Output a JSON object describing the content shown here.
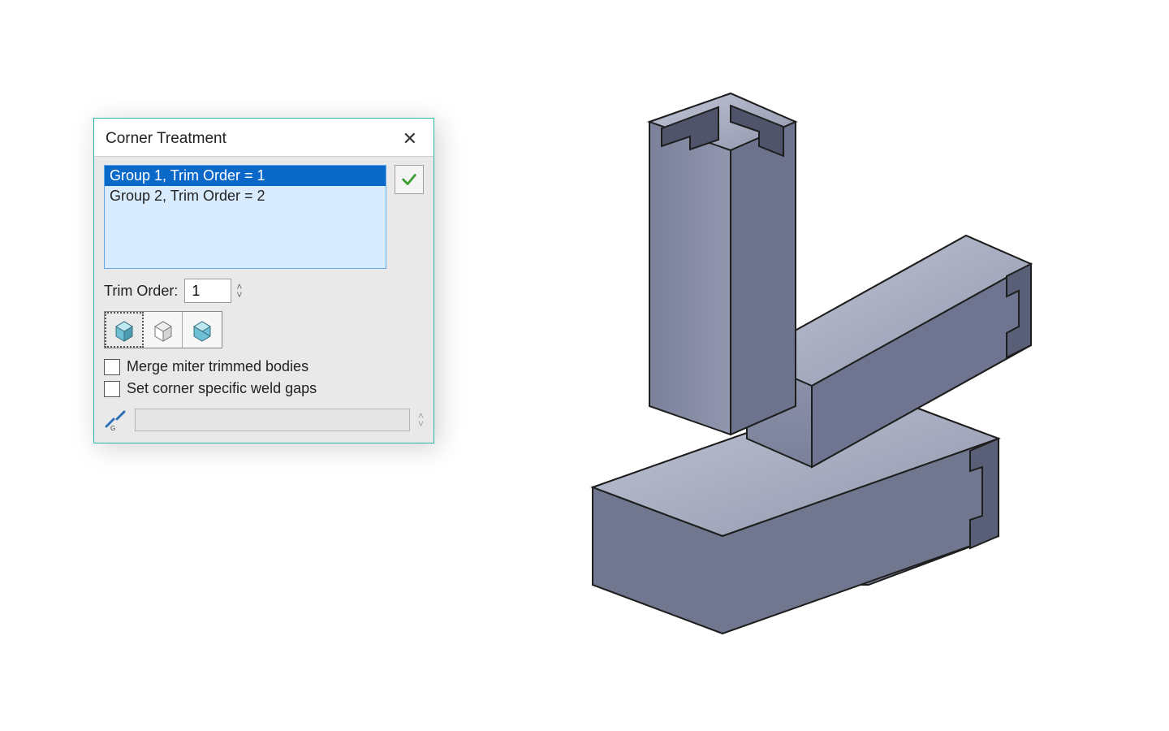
{
  "dialog": {
    "title": "Corner Treatment",
    "groups": [
      {
        "label": "Group 1, Trim Order = 1",
        "selected": true
      },
      {
        "label": "Group 2, Trim Order = 2",
        "selected": false
      }
    ],
    "trim_order_label": "Trim Order:",
    "trim_order_value": "1",
    "corner_mode_buttons": [
      "trim-butt1",
      "trim-butt2",
      "trim-miter"
    ],
    "corner_mode_selected_index": 0,
    "checkboxes": {
      "merge_label": "Merge miter trimmed bodies",
      "merge_checked": false,
      "weldgap_label": "Set corner specific weld gaps",
      "weldgap_checked": false
    },
    "weld_gap_value": "",
    "colors": {
      "accent": "#2ab89f",
      "selection": "#0a69c8",
      "listbg": "#d9ecff"
    }
  },
  "viewport": {
    "description": "3D isometric render of three structural steel C-channel members meeting at a corner joint",
    "member_profile": "C-channel",
    "member_count": 3,
    "render_color": "#8e94aa"
  }
}
